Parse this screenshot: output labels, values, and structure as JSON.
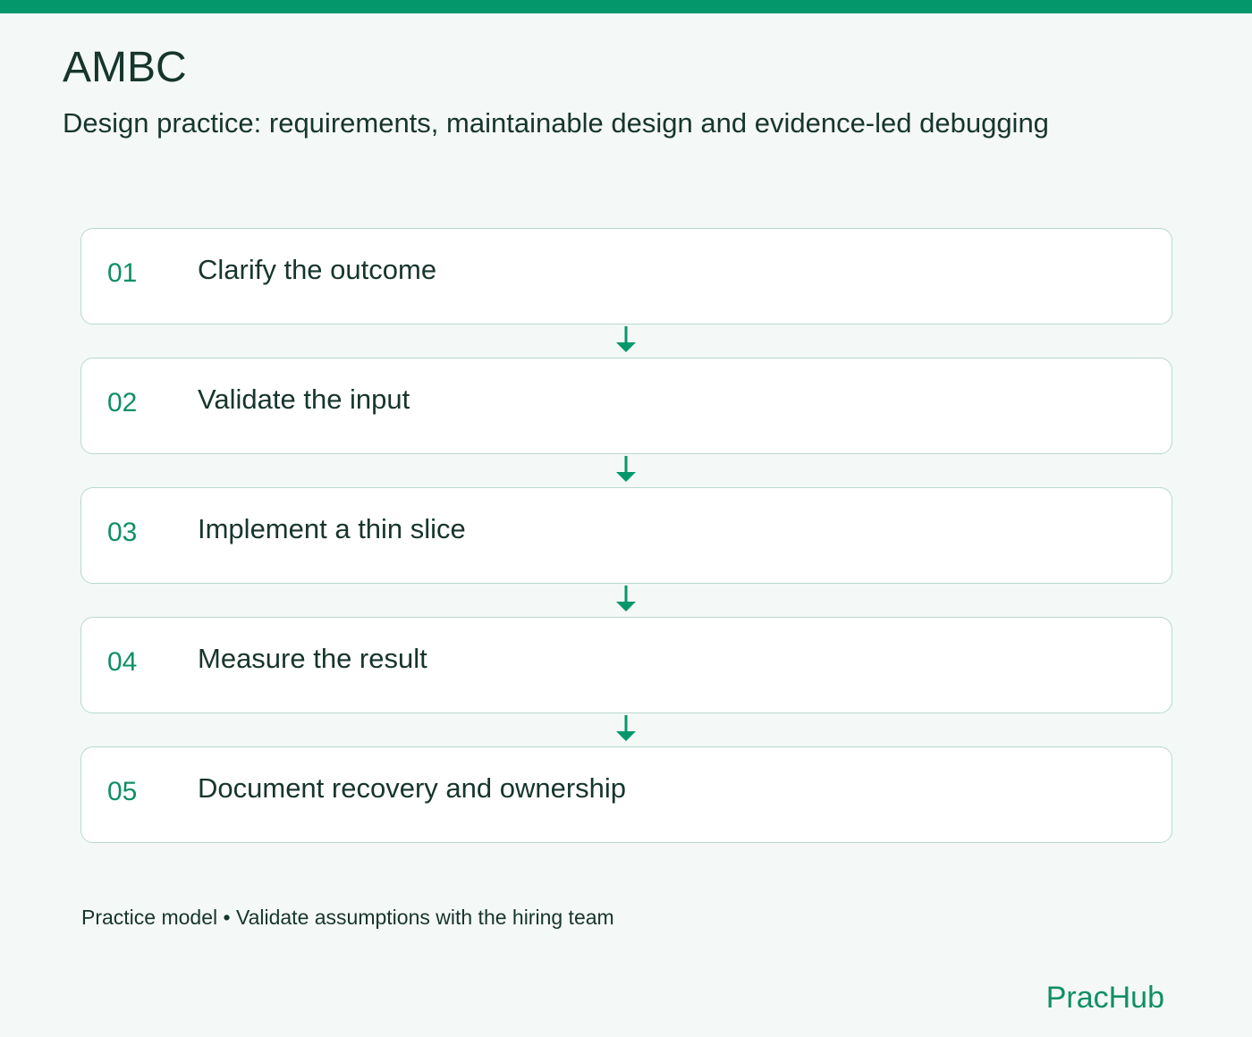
{
  "header": {
    "title": "AMBC",
    "subtitle": "Design practice: requirements, maintainable design and evidence-led debugging"
  },
  "steps": [
    {
      "number": "01",
      "label": "Clarify the outcome"
    },
    {
      "number": "02",
      "label": "Validate the input"
    },
    {
      "number": "03",
      "label": "Implement a thin slice"
    },
    {
      "number": "04",
      "label": "Measure the result"
    },
    {
      "number": "05",
      "label": "Document recovery and ownership"
    }
  ],
  "footer": {
    "note": "Practice model • Validate assumptions with the hiring team",
    "brand": "PracHub"
  },
  "colors": {
    "accent": "#04976b",
    "text": "#17352d",
    "card_border": "#b9d9cd",
    "background": "#f4f8f6"
  }
}
